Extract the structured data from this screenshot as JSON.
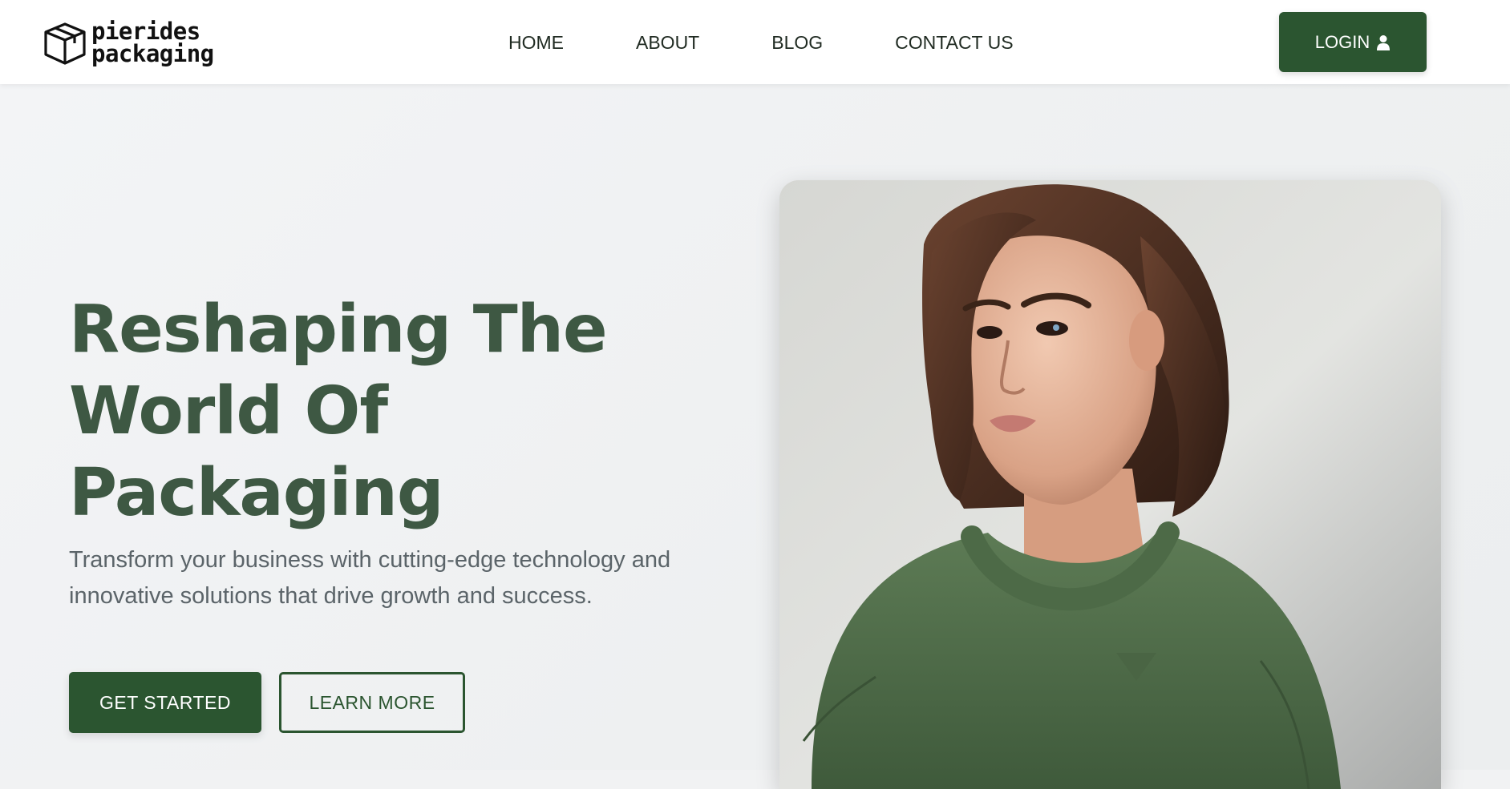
{
  "brand": {
    "line1": "pierides",
    "line2": "packaging"
  },
  "nav": {
    "items": [
      {
        "label": "HOME"
      },
      {
        "label": "ABOUT"
      },
      {
        "label": "BLOG"
      },
      {
        "label": "CONTACT US"
      }
    ],
    "login_label": "LOGIN"
  },
  "hero": {
    "title_line1": "Reshaping The",
    "title_line2": "World Of",
    "title_line3": "Packaging",
    "subtitle": "Transform your business with cutting-edge technology and innovative solutions that drive growth and success.",
    "primary_cta": "GET STARTED",
    "secondary_cta": "LEARN MORE",
    "image_icon": "portrait-photo"
  },
  "colors": {
    "brand_green": "#2b5530",
    "title_green": "#3e5843",
    "text_gray": "#5b6469",
    "page_bg": "#f1f2f3"
  }
}
